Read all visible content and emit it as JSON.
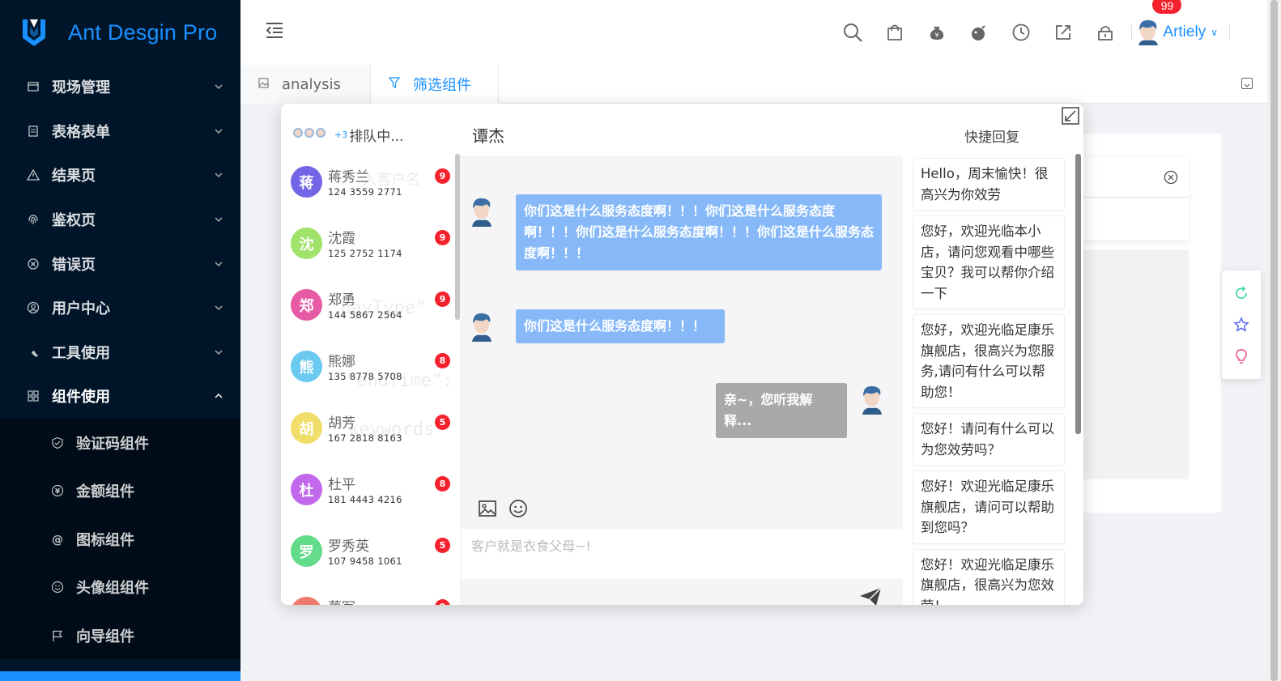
{
  "app": {
    "title": "Ant Desgin Pro"
  },
  "sidebar": {
    "items": [
      {
        "label": "现场管理",
        "icon": "store-icon"
      },
      {
        "label": "表格表单",
        "icon": "form-icon"
      },
      {
        "label": "结果页",
        "icon": "warning-icon"
      },
      {
        "label": "鉴权页",
        "icon": "fingerprint-icon"
      },
      {
        "label": "错误页",
        "icon": "close-circle-icon"
      },
      {
        "label": "用户中心",
        "icon": "user-icon"
      },
      {
        "label": "工具使用",
        "icon": "tool-icon"
      },
      {
        "label": "组件使用",
        "icon": "appstore-icon"
      }
    ],
    "submenu": [
      {
        "label": "验证码组件",
        "icon": "shield-check-icon"
      },
      {
        "label": "金额组件",
        "icon": "yen-icon"
      },
      {
        "label": "图标组件",
        "icon": "at-icon"
      },
      {
        "label": "头像组组件",
        "icon": "smile-icon"
      },
      {
        "label": "向导组件",
        "icon": "flag-icon"
      }
    ]
  },
  "header": {
    "user_name": "Artiely",
    "badge_count": "99",
    "icons": [
      "search-icon",
      "shopping-icon",
      "money-bag-icon",
      "bomb-icon",
      "clock-icon",
      "export-icon",
      "lock-icon"
    ]
  },
  "tabs": [
    {
      "label": "analysis",
      "icon": "image-icon",
      "active": false
    },
    {
      "label": "筛选组件",
      "icon": "filter-icon",
      "active": true
    }
  ],
  "chat": {
    "queue_label": "排队中...",
    "queue_extra": "+3",
    "contact_name": "谭杰",
    "input_placeholder": "客户就是衣食父母~!",
    "messages": [
      {
        "from": "customer",
        "text": "你们这是什么服务态度啊！！！你们这是什么服务态度啊！！！你们这是什么服务态度啊！！！你们这是什么服务态度啊！！！"
      },
      {
        "from": "customer",
        "text": "你们这是什么服务态度啊！！！"
      },
      {
        "from": "agent",
        "text": "亲~，您听我解释..."
      }
    ],
    "queue": [
      {
        "initial": "蒋",
        "name": "蒋秀兰",
        "phone": "124 3559 2771",
        "badge": "9",
        "color": "#7265e6"
      },
      {
        "initial": "沈",
        "name": "沈霞",
        "phone": "125 2752 1174",
        "badge": "9",
        "color": "#a0e26a"
      },
      {
        "initial": "郑",
        "name": "郑勇",
        "phone": "144 5867 2564",
        "badge": "9",
        "color": "#e65aa6"
      },
      {
        "initial": "熊",
        "name": "熊娜",
        "phone": "135 8778 5708",
        "badge": "8",
        "color": "#6cc9f0"
      },
      {
        "initial": "胡",
        "name": "胡芳",
        "phone": "167 2818 8163",
        "badge": "5",
        "color": "#f0dd6a"
      },
      {
        "initial": "杜",
        "name": "杜平",
        "phone": "181 4443 4216",
        "badge": "8",
        "color": "#c169ea"
      },
      {
        "initial": "罗",
        "name": "罗秀英",
        "phone": "107 9458 1061",
        "badge": "5",
        "color": "#62db8a"
      },
      {
        "initial": "",
        "name": "蔡军",
        "phone": "",
        "badge": "9",
        "color": "#f07a6a"
      }
    ],
    "quick_title": "快捷回复",
    "quick_replies": [
      "Hello，周末愉快！很高兴为你效劳",
      "您好，欢迎光临本小店，请问您观看中哪些宝贝？我可以帮你介绍一下",
      "您好，欢迎光临足康乐旗舰店，很高兴为您服务,请问有什么可以帮助您！",
      "您好！请问有什么可以为您效劳吗？",
      "您好！欢迎光临足康乐旗舰店，请问可以帮助到您吗？",
      "您好！欢迎光临足康乐旗舰店，很高兴为您效劳！"
    ]
  }
}
